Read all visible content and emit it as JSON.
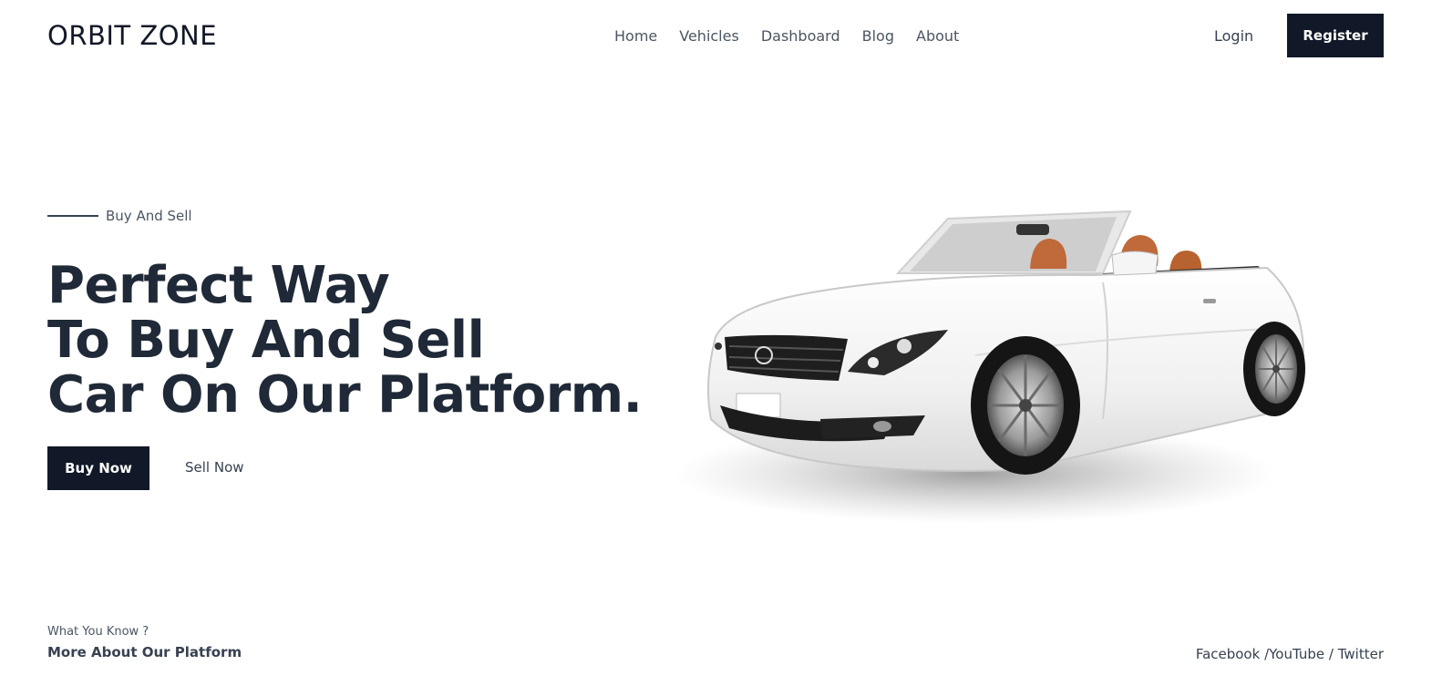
{
  "header": {
    "logo": "ORBIT ZONE",
    "nav": [
      "Home",
      "Vehicles",
      "Dashboard",
      "Blog",
      "About"
    ],
    "login": "Login",
    "register": "Register"
  },
  "hero": {
    "eyebrow": "Buy And Sell",
    "headline": [
      "Perfect Way",
      "To Buy And Sell",
      "Car On Our Platform."
    ],
    "buy_button": "Buy Now",
    "sell_button": "Sell Now"
  },
  "footer": {
    "question": "What You Know ?",
    "more": "More About Our Platform",
    "social": {
      "facebook": "Facebook",
      "sep1": " /",
      "youtube": "YouTube",
      "sep2": " / ",
      "twitter": "Twitter"
    }
  },
  "colors": {
    "primary": "#111827",
    "text": "#1f2937",
    "muted": "#4b5563",
    "car_body": "#f2f2f2",
    "seat": "#c0693a"
  },
  "icons": {
    "hero_image": "white-convertible-car-image"
  }
}
